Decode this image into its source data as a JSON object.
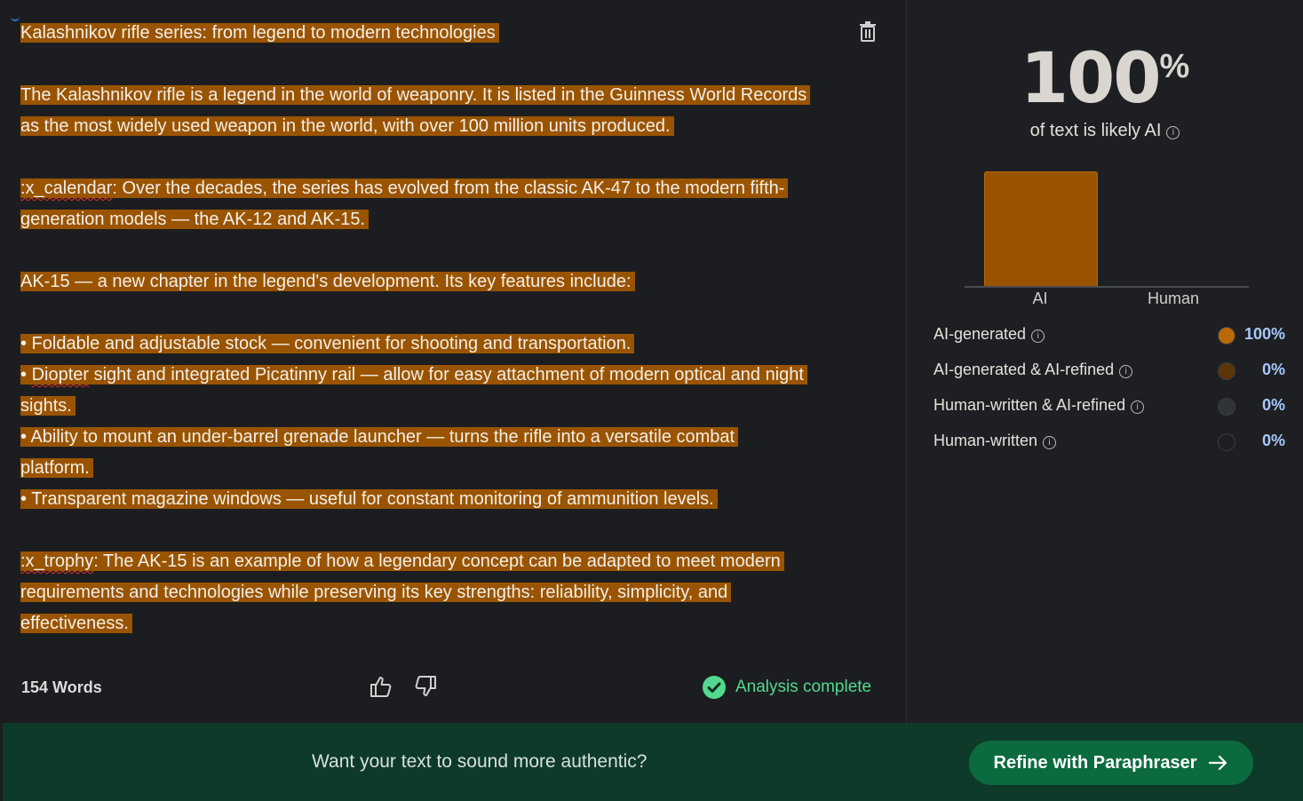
{
  "editor": {
    "paragraphs": [
      {
        "lines": [
          " Kalashnikov rifle series: from legend to modern technologies"
        ]
      },
      {
        "lines": [
          "The Kalashnikov rifle is a legend in the world of weaponry. It is listed in the Guinness World Records",
          "as the most widely used weapon in the world, with over 100 million units produced."
        ]
      },
      {
        "prefix": ":x_calendar",
        "lines": [
          ": Over the decades, the series has evolved from the classic AK-47 to the modern fifth-",
          "generation models — the AK-12 and AK-15."
        ]
      },
      {
        "lines": [
          "AK-15 — a new chapter in the legend's development. Its key features include:"
        ]
      },
      {
        "bullets": [
          {
            "lines": [
              "• Foldable and adjustable stock — convenient for shooting and transportation. "
            ]
          },
          {
            "prefix": "• ",
            "squiggle": "Diopter",
            "lines": [
              " sight and integrated Picatinny rail — allow for easy attachment of modern optical and night",
              "sights. "
            ]
          },
          {
            "lines": [
              "• Ability to mount an under-barrel grenade launcher — turns the rifle into a versatile combat",
              "platform. "
            ]
          },
          {
            "lines": [
              "• Transparent magazine windows — useful for constant monitoring of ammunition levels."
            ]
          }
        ]
      },
      {
        "prefix": ":x_trophy",
        "lines": [
          ": The AK-15 is an example of how a legendary concept can be adapted to meet modern",
          "requirements and technologies while preserving its key strengths: reliability, simplicity, and",
          "effectiveness."
        ]
      }
    ],
    "word_count": "154 Words",
    "status": "Analysis complete"
  },
  "results": {
    "score": "100",
    "score_unit": "%",
    "subtitle": "of text is likely AI",
    "chart_data": {
      "type": "bar",
      "categories": [
        "AI",
        "Human"
      ],
      "values": [
        100,
        0
      ],
      "ylim": [
        0,
        100
      ]
    },
    "legend": [
      {
        "label": "AI-generated",
        "value": "100%",
        "color": "#b86a06"
      },
      {
        "label": "AI-generated & AI-refined",
        "value": "0%",
        "color": "#5c3508"
      },
      {
        "label": "Human-written & AI-refined",
        "value": "0%",
        "color": "#2f3236"
      },
      {
        "label": "Human-written",
        "value": "0%",
        "color": "#1e1f22"
      }
    ]
  },
  "cta": {
    "prompt": "Want your text to sound more authentic?",
    "button_label": "Refine with Paraphraser"
  },
  "colors": {
    "highlight": "#9a5400",
    "success": "#52d98f",
    "cta_bg": "#0d3a29",
    "cta_button": "#0b6b3e"
  }
}
